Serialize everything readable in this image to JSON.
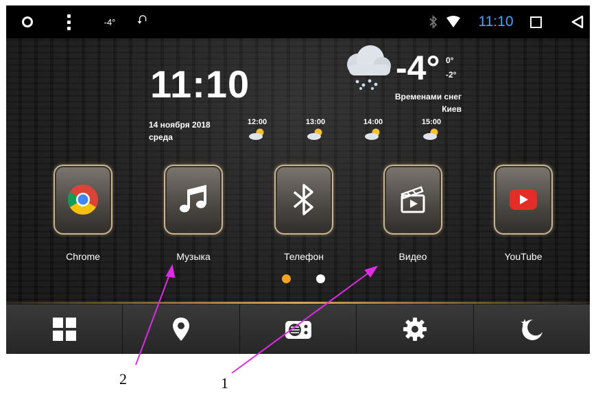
{
  "status_bar": {
    "temperature": "-4°",
    "time": "11:10"
  },
  "clock": {
    "time": "11:10",
    "date": "14 ноября 2018",
    "weekday": "среда"
  },
  "weather": {
    "current_temp": "-4°",
    "high": "0°",
    "low": "-2°",
    "condition": "Временами снег",
    "city": "Киев",
    "forecast": [
      {
        "time": "12:00"
      },
      {
        "time": "13:00"
      },
      {
        "time": "14:00"
      },
      {
        "time": "15:00"
      }
    ]
  },
  "apps": [
    {
      "label": "Chrome",
      "icon": "chrome-icon"
    },
    {
      "label": "Музыка",
      "icon": "music-note-icon"
    },
    {
      "label": "Телефон",
      "icon": "bluetooth-icon"
    },
    {
      "label": "Видео",
      "icon": "video-clapper-icon"
    },
    {
      "label": "YouTube",
      "icon": "youtube-icon"
    }
  ],
  "page_indicator": {
    "pages": 2,
    "active": 1
  },
  "dock": [
    {
      "icon": "app-grid-icon"
    },
    {
      "icon": "location-pin-icon"
    },
    {
      "icon": "radio-icon"
    },
    {
      "icon": "settings-gear-icon"
    },
    {
      "icon": "night-mode-icon"
    }
  ],
  "annotations": {
    "label_1": "1",
    "label_2": "2"
  },
  "colors": {
    "accent_blue": "#3fa6ff",
    "active_dot": "#f3a51f",
    "annotation_arrow": "#e02be6",
    "tile_border": "#c8b692"
  }
}
